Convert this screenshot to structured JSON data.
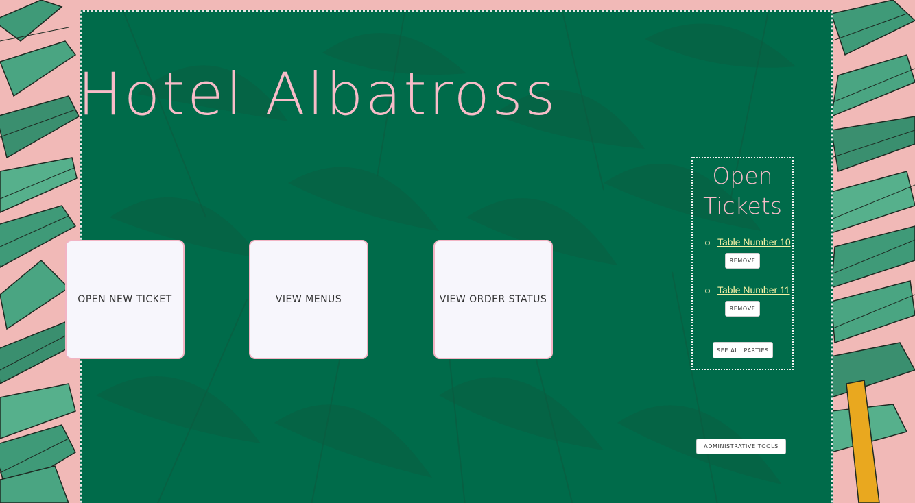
{
  "app": {
    "title": "Hotel Albatross"
  },
  "tiles": [
    {
      "label": "OPEN NEW TICKET"
    },
    {
      "label": "VIEW MENUS"
    },
    {
      "label": "VIEW ORDER STATUS"
    }
  ],
  "tickets": {
    "title": "Open Tickets",
    "items": [
      {
        "label": "Table Number 10",
        "remove_label": "REMOVE"
      },
      {
        "label": "Table Number 11",
        "remove_label": "REMOVE"
      }
    ],
    "see_all_label": "SEE ALL PARTIES"
  },
  "admin": {
    "label": "ADMINISTRATIVE TOOLS"
  },
  "colors": {
    "background": "#f1b9b7",
    "panel": "#006b4a",
    "title": "#f7bcc8",
    "link": "#f6f1a4"
  }
}
